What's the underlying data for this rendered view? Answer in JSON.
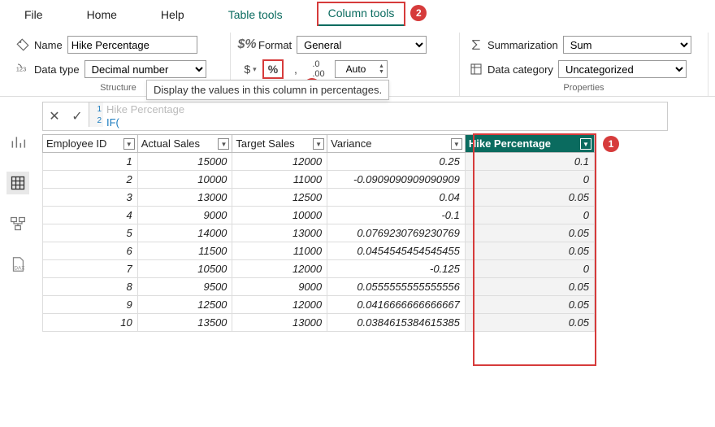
{
  "tabs": {
    "file": "File",
    "home": "Home",
    "help": "Help",
    "table_tools": "Table tools",
    "column_tools": "Column tools"
  },
  "badges": {
    "column_tools": "2",
    "percent": "3",
    "hike_col": "1"
  },
  "ribbon": {
    "structure": {
      "name_label": "Name",
      "name_value": "Hike Percentage",
      "datatype_label": "Data type",
      "datatype_value": "Decimal number",
      "group_label": "Structure"
    },
    "formatting": {
      "format_label": "Format",
      "format_value": "General",
      "auto_value": "Auto",
      "tooltip": "Display the values in this column in percentages."
    },
    "properties": {
      "summ_label": "Summarization",
      "summ_value": "Sum",
      "cat_label": "Data category",
      "cat_value": "Uncategorized",
      "group_label": "Properties"
    }
  },
  "formula": {
    "line1_dim": "Hike Percentage",
    "line2": "IF("
  },
  "columns": [
    "Employee ID",
    "Actual Sales",
    "Target Sales",
    "Variance",
    "Hike Percentage"
  ],
  "rows": [
    {
      "id": "1",
      "actual": "15000",
      "target": "12000",
      "var": "0.25",
      "hike": "0.1"
    },
    {
      "id": "2",
      "actual": "10000",
      "target": "11000",
      "var": "-0.0909090909090909",
      "hike": "0"
    },
    {
      "id": "3",
      "actual": "13000",
      "target": "12500",
      "var": "0.04",
      "hike": "0.05"
    },
    {
      "id": "4",
      "actual": "9000",
      "target": "10000",
      "var": "-0.1",
      "hike": "0"
    },
    {
      "id": "5",
      "actual": "14000",
      "target": "13000",
      "var": "0.0769230769230769",
      "hike": "0.05"
    },
    {
      "id": "6",
      "actual": "11500",
      "target": "11000",
      "var": "0.0454545454545455",
      "hike": "0.05"
    },
    {
      "id": "7",
      "actual": "10500",
      "target": "12000",
      "var": "-0.125",
      "hike": "0"
    },
    {
      "id": "8",
      "actual": "9500",
      "target": "9000",
      "var": "0.0555555555555556",
      "hike": "0.05"
    },
    {
      "id": "9",
      "actual": "12500",
      "target": "12000",
      "var": "0.0416666666666667",
      "hike": "0.05"
    },
    {
      "id": "10",
      "actual": "13500",
      "target": "13000",
      "var": "0.0384615384615385",
      "hike": "0.05"
    }
  ]
}
